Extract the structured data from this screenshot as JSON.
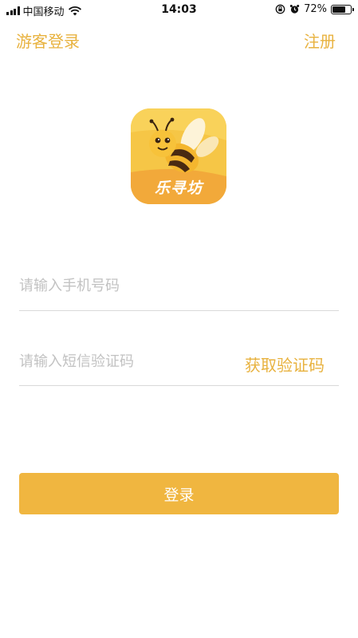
{
  "status_bar": {
    "carrier": "中国移动",
    "time": "14:03",
    "battery_percent": "72%",
    "battery_level": 0.72,
    "icons": [
      "signal-icon",
      "wifi-icon",
      "orientation-lock-icon",
      "alarm-icon",
      "battery-icon"
    ]
  },
  "nav": {
    "guest_login": "游客登录",
    "register": "注册"
  },
  "logo": {
    "text": "乐寻坊",
    "icon": "bee-logo-icon"
  },
  "form": {
    "phone_placeholder": "请输入手机号码",
    "phone_value": "",
    "code_placeholder": "请输入短信验证码",
    "code_value": "",
    "get_code_label": "获取验证码",
    "login_label": "登录"
  },
  "colors": {
    "accent": "#e8b23f",
    "button": "#f0b640",
    "placeholder": "#c2c2c2",
    "divider": "#d9d9d9"
  }
}
